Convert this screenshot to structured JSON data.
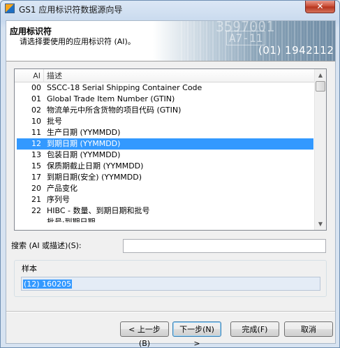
{
  "window": {
    "title": "GS1 应用标识符数据源向导",
    "close_label": "✕"
  },
  "banner": {
    "heading": "应用标识符",
    "subheading": "请选择要使用的应用标识符 (AI)。",
    "deco_number": "3597001",
    "deco_code": "A7-11",
    "code": "(01) 1942112"
  },
  "list": {
    "columns": {
      "ai": "AI",
      "description": "描述"
    },
    "rows": [
      {
        "ai": "00",
        "description": "SSCC-18 Serial Shipping Container Code"
      },
      {
        "ai": "01",
        "description": "Global Trade Item Number (GTIN)"
      },
      {
        "ai": "02",
        "description": "物流单元中所含货物的项目代码 (GTIN)"
      },
      {
        "ai": "10",
        "description": "批号"
      },
      {
        "ai": "11",
        "description": "生产日期 (YYMMDD)"
      },
      {
        "ai": "12",
        "description": "到期日期 (YYMMDD)"
      },
      {
        "ai": "13",
        "description": "包装日期 (YYMMDD)"
      },
      {
        "ai": "15",
        "description": "保质期截止日期 (YYMMDD)"
      },
      {
        "ai": "17",
        "description": "到期日期(安全) (YYMMDD)"
      },
      {
        "ai": "20",
        "description": "产品变化"
      },
      {
        "ai": "21",
        "description": "序列号"
      },
      {
        "ai": "22",
        "description": "HIBC - 数量、到期日期和批号"
      },
      {
        "ai": "",
        "description": "批号·到期日期"
      }
    ],
    "selected_index": 5
  },
  "search": {
    "label": "搜索 (AI 或描述)(S):",
    "value": ""
  },
  "sample": {
    "label": "样本",
    "value": "(12) 160205"
  },
  "buttons": {
    "back": "< 上一步(B)",
    "next": "下一步(N) >",
    "finish": "完成(F)",
    "cancel": "取消"
  }
}
